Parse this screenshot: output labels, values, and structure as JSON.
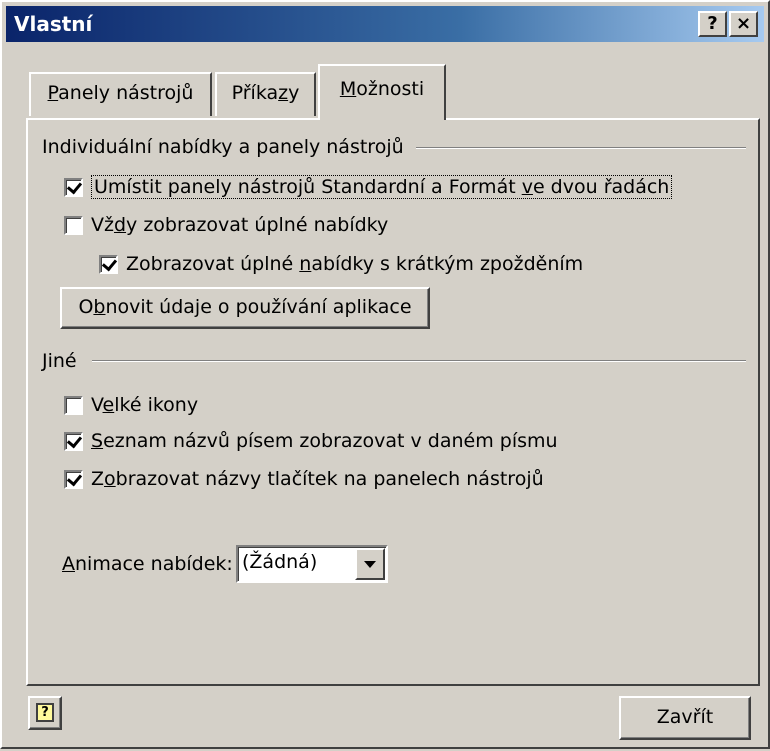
{
  "window": {
    "title": "Vlastní",
    "help_button": "?",
    "close_button": "×"
  },
  "tabs": [
    {
      "label_pre": "",
      "label_u": "P",
      "label_post": "anely nástrojů",
      "active": false
    },
    {
      "label_pre": "Příka",
      "label_u": "z",
      "label_post": "y",
      "active": false
    },
    {
      "label_pre": "",
      "label_u": "M",
      "label_post": "ožnosti",
      "active": true
    }
  ],
  "section_menus": {
    "label": "Individuální nabídky a panely nástrojů",
    "options": [
      {
        "pre": "Umístit panely nástrojů Standardní a Formát ",
        "u": "v",
        "post": "e dvou řadách",
        "checked": true
      },
      {
        "pre": "Vž",
        "u": "d",
        "post": "y zobrazovat úplné nabídky",
        "checked": false
      },
      {
        "pre": "Zobrazovat úplné ",
        "u": "n",
        "post": "abídky s krátkým zpožděním",
        "checked": true
      }
    ],
    "reset_button": {
      "pre": "O",
      "u": "b",
      "post": "novit údaje o používání aplikace"
    }
  },
  "section_other": {
    "label": "Jiné",
    "options": [
      {
        "pre": "V",
        "u": "e",
        "post": "lké ikony",
        "checked": false
      },
      {
        "pre": "",
        "u": "S",
        "post": "eznam názvů písem zobrazovat v daném písmu",
        "checked": true
      },
      {
        "pre": "Z",
        "u": "o",
        "post": "brazovat názvy tlačítek na panelech nástrojů",
        "checked": true
      }
    ],
    "animation": {
      "label_u": "A",
      "label_post": "nimace nabídek:",
      "value": "(Žádná)"
    }
  },
  "footer": {
    "help_icon": "?",
    "close_label": "Zavřít"
  },
  "colors": {
    "face": "#d4d0c8",
    "title_start": "#0a246a",
    "title_end": "#a6caf0"
  }
}
